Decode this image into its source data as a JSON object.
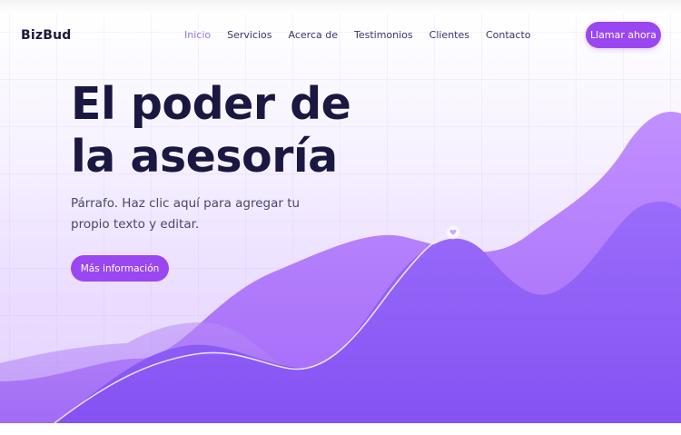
{
  "header": {
    "logo": "BizBud",
    "nav": [
      {
        "label": "Inicio",
        "active": true
      },
      {
        "label": "Servicios",
        "active": false
      },
      {
        "label": "Acerca de",
        "active": false
      },
      {
        "label": "Testimonios",
        "active": false
      },
      {
        "label": "Clientes",
        "active": false
      },
      {
        "label": "Contacto",
        "active": false
      }
    ],
    "cta_label": "Llamar ahora"
  },
  "hero": {
    "title_line1": "El poder de",
    "title_line2": "la asesoría",
    "paragraph": "Párrafo. Haz clic aquí para agregar tu propio texto y editar.",
    "button_label": "Más información"
  },
  "colors": {
    "accent": "#9a47f2",
    "title": "#1a1740",
    "nav_active": "#9a78e6",
    "wave_back": "#b584fb",
    "wave_front": "#8d5ff5"
  },
  "icons": {
    "chart_marker": "heart-icon"
  }
}
